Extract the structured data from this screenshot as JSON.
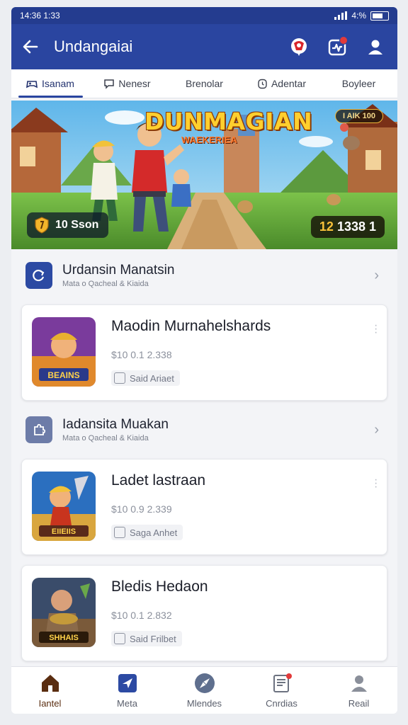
{
  "status_bar": {
    "time": "14:36  1:33",
    "battery": "4:%"
  },
  "app_bar": {
    "title": "Undangaiai",
    "back_icon": "arrow-left-icon",
    "actions": [
      "gift-notification-icon",
      "activity-icon",
      "user-profile-icon"
    ]
  },
  "tabs": [
    {
      "label": "Isanam",
      "icon": "gamepad-icon",
      "active": true
    },
    {
      "label": "Nenesr",
      "icon": "chat-icon",
      "active": false
    },
    {
      "label": "Brenolar",
      "icon": "",
      "active": false
    },
    {
      "label": "Adentar",
      "icon": "clock-icon",
      "active": false
    },
    {
      "label": "Boyleer",
      "icon": "",
      "active": false
    }
  ],
  "banner": {
    "title": "DUNMAGIAN",
    "subtitle": "WAEKERIEA",
    "pill": "I AIK   100",
    "left_badge": "10  Sson",
    "right_badge_highlight": "12",
    "right_badge_text": "1338  1"
  },
  "sections": [
    {
      "title": "Urdansin Manatsin",
      "subtitle": "Mata o Qacheal & Kiaida",
      "icon": "refresh-icon",
      "icon_color": "#2c4aa3",
      "games": [
        {
          "name": "Maodin Murnahelshards",
          "price": "$10 0.1 2.338",
          "tag": "Said Ariaet",
          "image_label": "BEAINS",
          "image_colors": [
            "#7a3b9c",
            "#e0892c"
          ]
        }
      ]
    },
    {
      "title": "Iadansita Muakan",
      "subtitle": "Mata o Qacheal & Kiaida",
      "icon": "puzzle-icon",
      "icon_color": "#6d7ca8",
      "games": [
        {
          "name": "Ladet lastraan",
          "price": "$10 0.9 2.339",
          "tag": "Saga Anhet",
          "image_label": "EIIEIIS",
          "image_colors": [
            "#2b6fbf",
            "#e0b04a"
          ]
        },
        {
          "name": "Bledis Hedaon",
          "price": "$10 0.1 2.832",
          "tag": "Said Frilbet",
          "image_label": "SHHAIS",
          "image_colors": [
            "#3a4c6a",
            "#c49a3a"
          ]
        }
      ]
    }
  ],
  "bottom_nav": [
    {
      "label": "Iantel",
      "icon": "home-icon",
      "active": true
    },
    {
      "label": "Meta",
      "icon": "navigation-icon",
      "active": false
    },
    {
      "label": "Mlendes",
      "icon": "compass-icon",
      "active": false
    },
    {
      "label": "Cnrdias",
      "icon": "news-icon",
      "active": false
    },
    {
      "label": "Reail",
      "icon": "person-icon",
      "active": false
    }
  ]
}
